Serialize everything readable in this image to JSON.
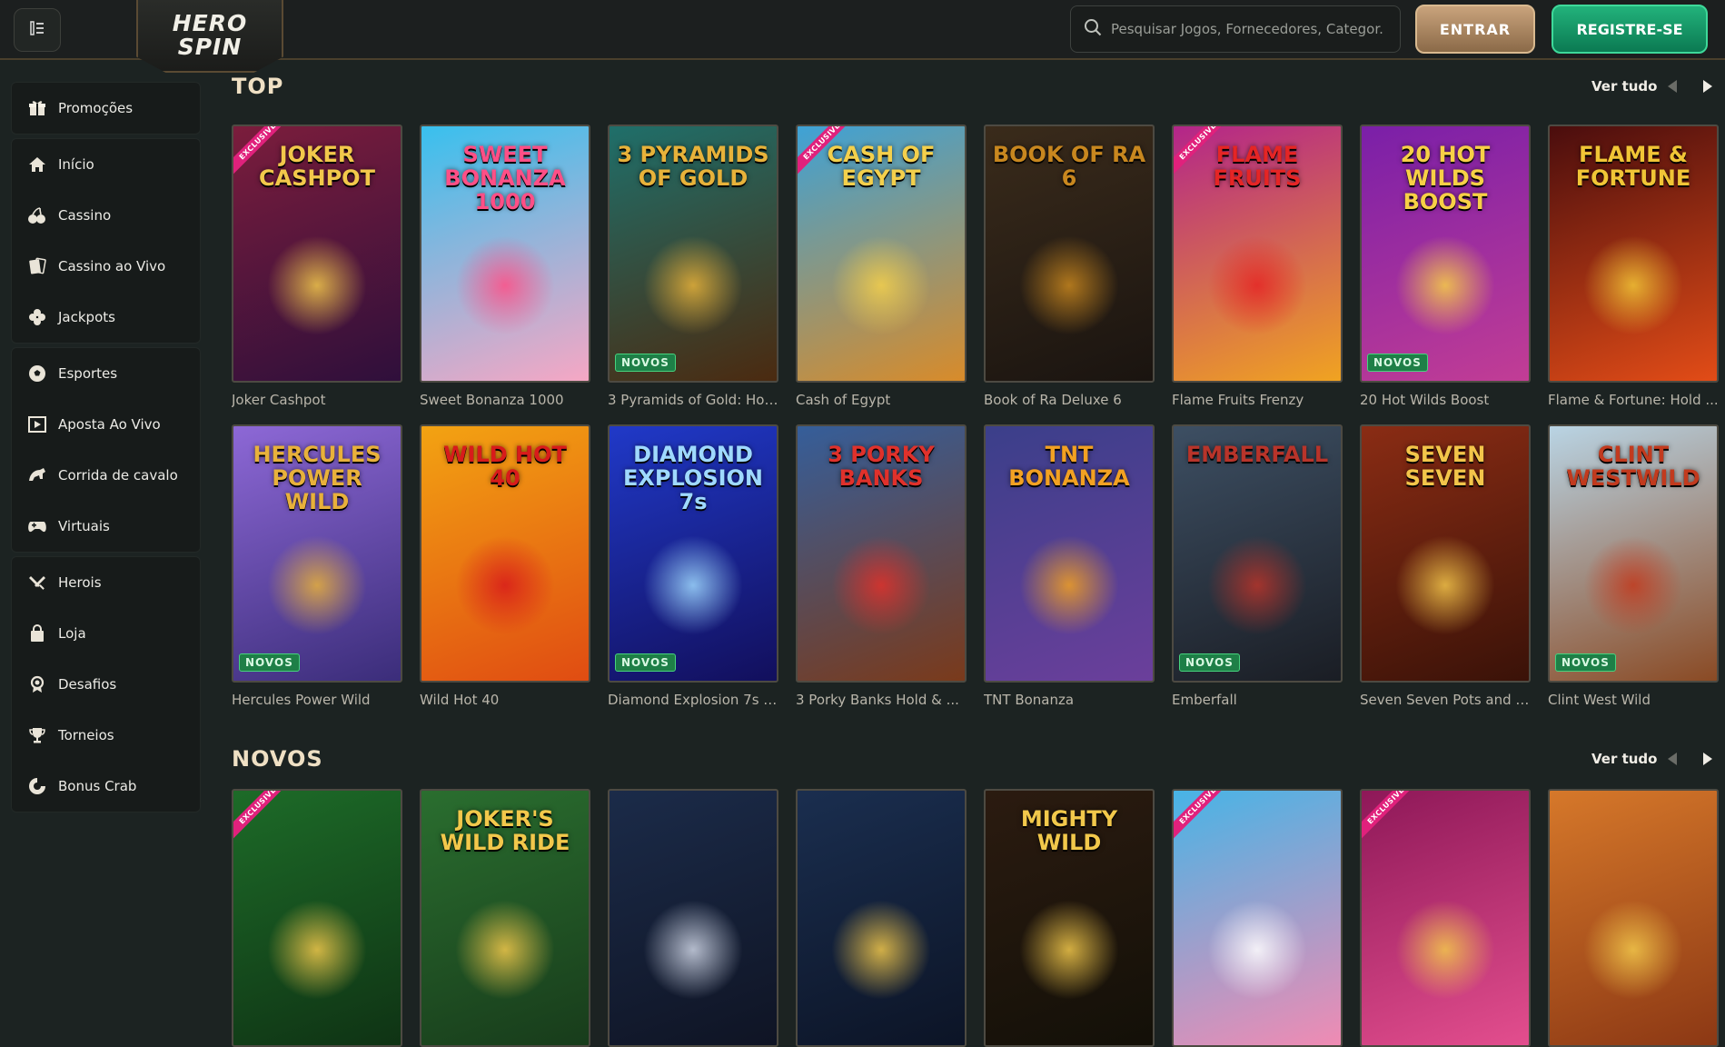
{
  "header": {
    "logo_line1": "HERO",
    "logo_line2": "SPIN",
    "search_placeholder": "Pesquisar Jogos, Fornecedores, Categor...",
    "login_label": "ENTRAR",
    "register_label": "REGISTRE-SE"
  },
  "sidebar": {
    "groups": [
      [
        {
          "label": "Promoções",
          "icon": "gift-icon"
        }
      ],
      [
        {
          "label": "Início",
          "icon": "home-icon"
        },
        {
          "label": "Cassino",
          "icon": "cherries-icon"
        },
        {
          "label": "Cassino ao Vivo",
          "icon": "cards-icon"
        },
        {
          "label": "Jackpots",
          "icon": "clover-icon"
        }
      ],
      [
        {
          "label": "Esportes",
          "icon": "soccer-ball-icon"
        },
        {
          "label": "Aposta Ao Vivo",
          "icon": "live-play-icon"
        },
        {
          "label": "Corrida de cavalo",
          "icon": "horse-icon"
        },
        {
          "label": "Virtuais",
          "icon": "gamepad-icon"
        }
      ],
      [
        {
          "label": "Herois",
          "icon": "sword-icon"
        },
        {
          "label": "Loja",
          "icon": "shopping-bag-icon"
        },
        {
          "label": "Desafios",
          "icon": "medal-icon"
        },
        {
          "label": "Torneios",
          "icon": "trophy-icon"
        },
        {
          "label": "Bonus Crab",
          "icon": "crab-icon"
        }
      ]
    ]
  },
  "sections": [
    {
      "title": "TOP",
      "see_all": "Ver tudo",
      "games": [
        {
          "name": "Joker Cashpot",
          "art": "JOKER CASHPOT",
          "exclusive": true,
          "novos": false,
          "bg": [
            "#7b1d3c",
            "#2f0f3b"
          ],
          "accent": "#f2c84b"
        },
        {
          "name": "Sweet Bonanza 1000",
          "art": "SWEET BONANZA 1000",
          "exclusive": false,
          "novos": false,
          "bg": [
            "#38c0ee",
            "#f6a7c4"
          ],
          "accent": "#ff4f86"
        },
        {
          "name": "3 Pyramids of Gold: Hol...",
          "art": "3 PYRAMIDS OF GOLD",
          "exclusive": false,
          "novos": true,
          "bg": [
            "#1f6f6a",
            "#4b2a10"
          ],
          "accent": "#e7b23a"
        },
        {
          "name": "Cash of Egypt",
          "art": "CASH OF EGYPT",
          "exclusive": true,
          "novos": false,
          "bg": [
            "#3ea2d6",
            "#d88b2a"
          ],
          "accent": "#f4d04c"
        },
        {
          "name": "Book of Ra Deluxe 6",
          "art": "BOOK OF RA 6",
          "exclusive": false,
          "novos": false,
          "bg": [
            "#3a2b1b",
            "#1a1410"
          ],
          "accent": "#c8871f"
        },
        {
          "name": "Flame Fruits Frenzy",
          "art": "FLAME FRUITS",
          "exclusive": true,
          "novos": false,
          "bg": [
            "#b3258a",
            "#f0a321"
          ],
          "accent": "#e52525"
        },
        {
          "name": "20 Hot Wilds Boost",
          "art": "20 HOT WILDS BOOST",
          "exclusive": false,
          "novos": true,
          "bg": [
            "#7a1fa8",
            "#c23d95"
          ],
          "accent": "#f7d046"
        },
        {
          "name": "Flame & Fortune: Hold ...",
          "art": "FLAME & FORTUNE",
          "exclusive": false,
          "novos": false,
          "bg": [
            "#4a0d0d",
            "#e24c17"
          ],
          "accent": "#f1c536"
        }
      ]
    },
    {
      "title": "",
      "see_all": "",
      "games": [
        {
          "name": "Hercules Power Wild",
          "art": "HERCULES POWER WILD",
          "exclusive": false,
          "novos": true,
          "bg": [
            "#8d68d6",
            "#3b2d7a"
          ],
          "accent": "#e8b13b"
        },
        {
          "name": "Wild Hot 40",
          "art": "WILD HOT 40",
          "exclusive": false,
          "novos": false,
          "bg": [
            "#f3a312",
            "#e04c12"
          ],
          "accent": "#d81b1b"
        },
        {
          "name": "Diamond Explosion 7s SE",
          "art": "DIAMOND EXPLOSION 7s",
          "exclusive": false,
          "novos": true,
          "bg": [
            "#2039c8",
            "#120f5c"
          ],
          "accent": "#9fd9ff"
        },
        {
          "name": "3 Porky Banks Hold & ...",
          "art": "3 PORKY BANKS",
          "exclusive": false,
          "novos": false,
          "bg": [
            "#355e9a",
            "#7a3a1b"
          ],
          "accent": "#e0312b"
        },
        {
          "name": "TNT Bonanza",
          "art": "TNT BONANZA",
          "exclusive": false,
          "novos": false,
          "bg": [
            "#3b3f8a",
            "#6b3f9b"
          ],
          "accent": "#f2a122"
        },
        {
          "name": "Emberfall",
          "art": "EMBERFALL",
          "exclusive": false,
          "novos": true,
          "bg": [
            "#3d4f63",
            "#1a1d24"
          ],
          "accent": "#b8342a"
        },
        {
          "name": "Seven Seven Pots and P...",
          "art": "SEVEN SEVEN",
          "exclusive": false,
          "novos": false,
          "bg": [
            "#8a2c14",
            "#3a1208"
          ],
          "accent": "#f3c54a"
        },
        {
          "name": "Clint West Wild",
          "art": "CLINT WESTWILD",
          "exclusive": false,
          "novos": true,
          "bg": [
            "#b9d4e4",
            "#8a4a24"
          ],
          "accent": "#c23a1e"
        }
      ]
    },
    {
      "title": "NOVOS",
      "see_all": "Ver tudo",
      "games": [
        {
          "name": "",
          "art": "",
          "exclusive": true,
          "novos": false,
          "bg": [
            "#1d6b28",
            "#0f3314"
          ],
          "accent": "#f2c84b"
        },
        {
          "name": "",
          "art": "JOKER'S WILD RIDE",
          "exclusive": false,
          "novos": false,
          "bg": [
            "#2a6e2f",
            "#183c1b"
          ],
          "accent": "#f2c84b"
        },
        {
          "name": "",
          "art": "",
          "exclusive": false,
          "novos": false,
          "bg": [
            "#1b2b49",
            "#0f1424"
          ],
          "accent": "#cfd6e6"
        },
        {
          "name": "",
          "art": "",
          "exclusive": false,
          "novos": false,
          "bg": [
            "#1a2e4f",
            "#0c1426"
          ],
          "accent": "#f2c84b"
        },
        {
          "name": "",
          "art": "MIGHTY WILD",
          "exclusive": false,
          "novos": false,
          "bg": [
            "#2b1b10",
            "#131008"
          ],
          "accent": "#f2c84b"
        },
        {
          "name": "",
          "art": "",
          "exclusive": true,
          "novos": false,
          "bg": [
            "#47b4e6",
            "#f08bb3"
          ],
          "accent": "#ffffff"
        },
        {
          "name": "",
          "art": "",
          "exclusive": true,
          "novos": false,
          "bg": [
            "#8e1858",
            "#e34e8e"
          ],
          "accent": "#f2c84b"
        },
        {
          "name": "",
          "art": "",
          "exclusive": false,
          "novos": false,
          "bg": [
            "#d6782a",
            "#8c3814"
          ],
          "accent": "#f2c84b"
        }
      ]
    }
  ],
  "labels": {
    "novos_badge": "NOVOS",
    "exclusive_ribbon": "EXCLUSIVE"
  }
}
